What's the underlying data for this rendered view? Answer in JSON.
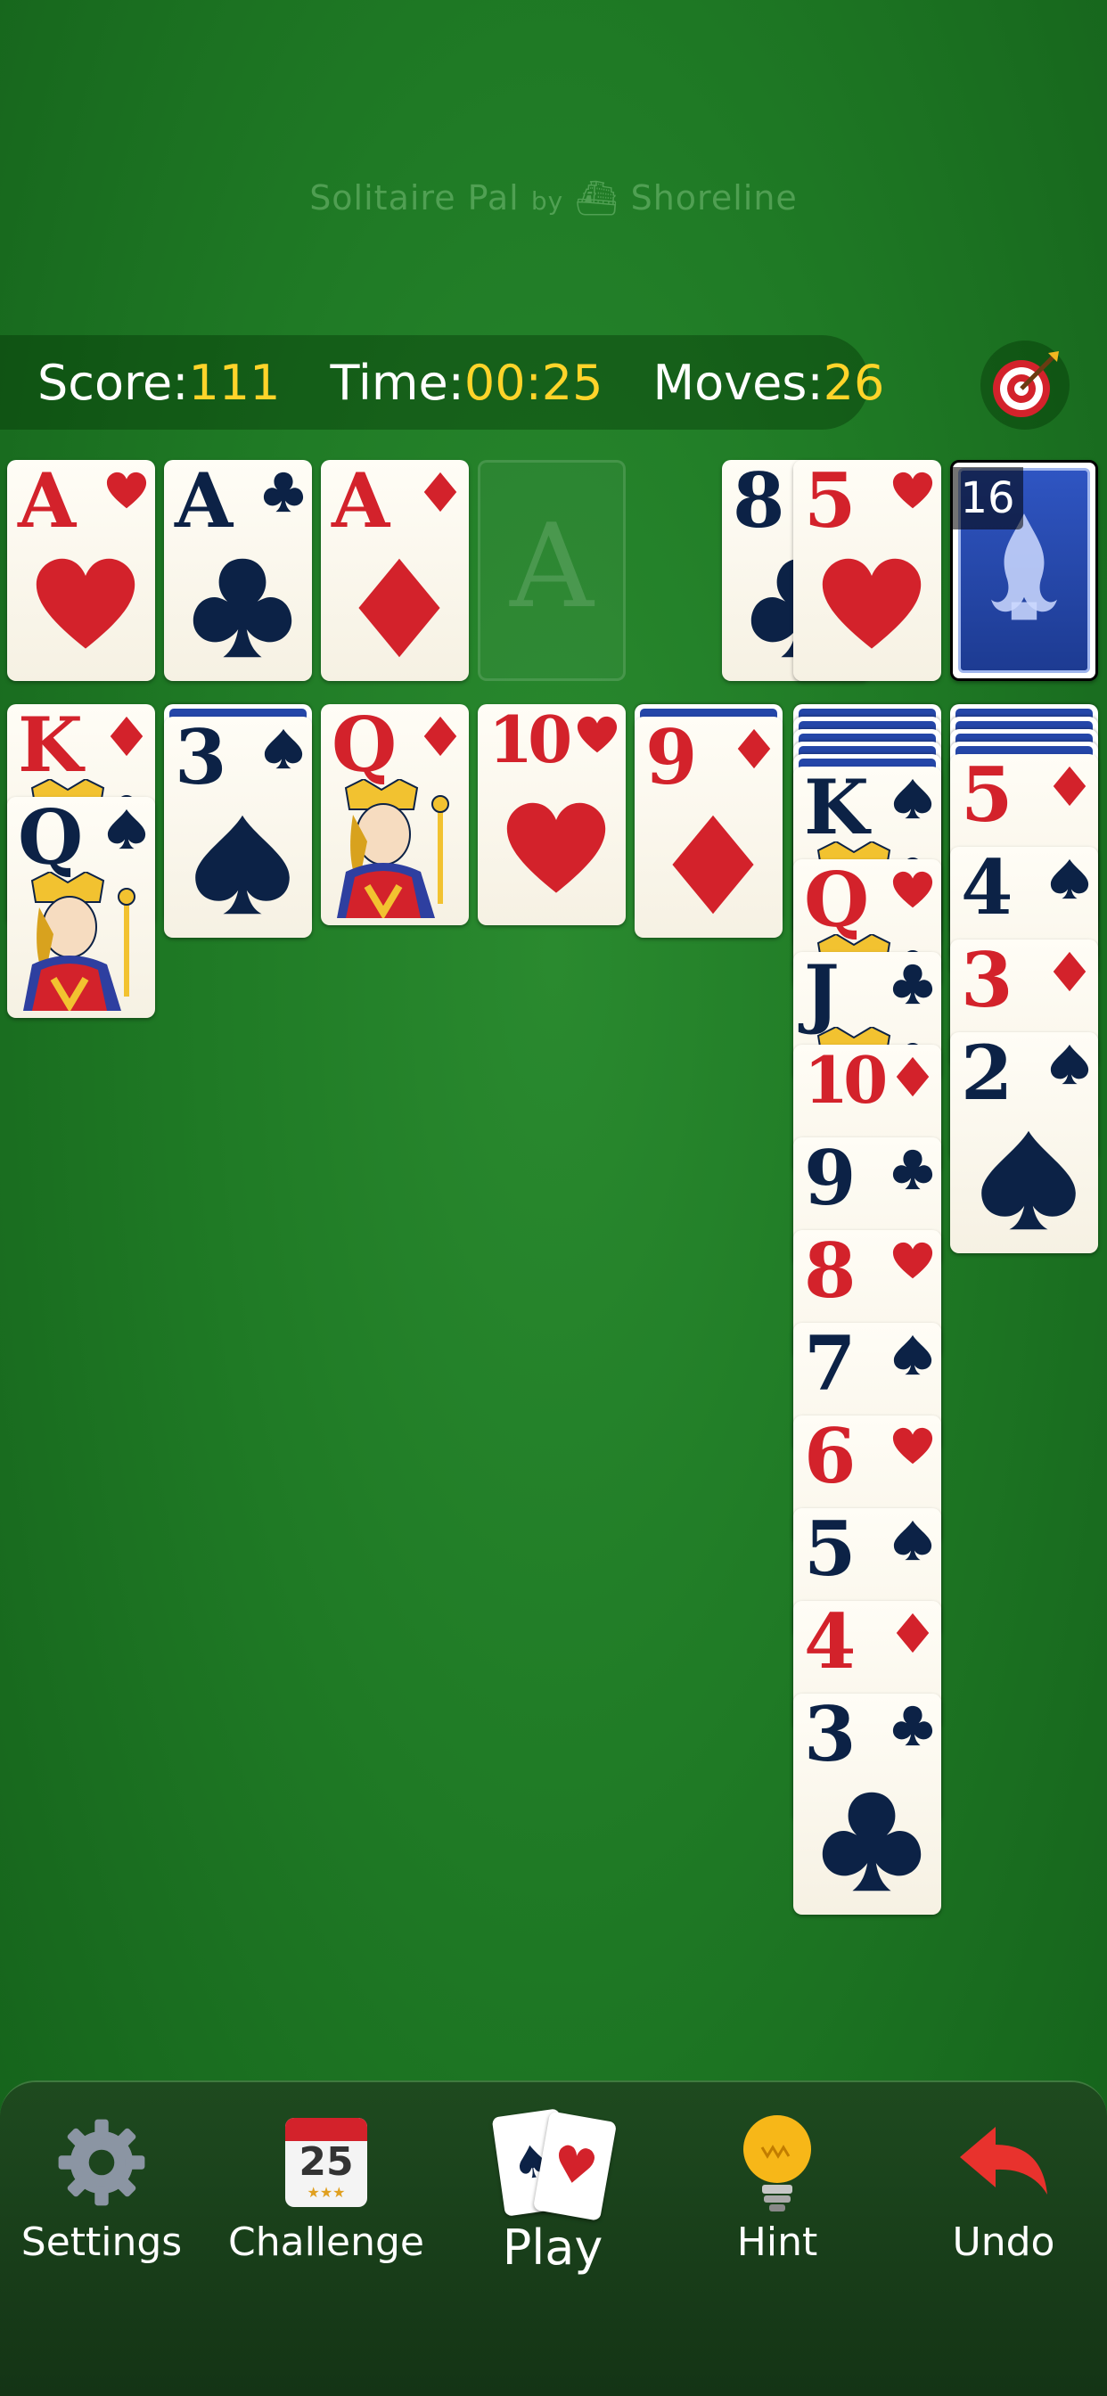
{
  "header": {
    "watermark_title": "Solitaire Pal",
    "watermark_by": "by",
    "watermark_brand": "Shoreline"
  },
  "status": {
    "score_label": "Score:",
    "score_value": "111",
    "time_label": "Time:",
    "time_value": "00:25",
    "moves_label": "Moves:",
    "moves_value": "26"
  },
  "foundations": [
    {
      "rank": "A",
      "suit": "hearts"
    },
    {
      "rank": "A",
      "suit": "clubs"
    },
    {
      "rank": "A",
      "suit": "diamonds"
    },
    {
      "rank": "",
      "suit": "",
      "placeholder": "A"
    }
  ],
  "waste": [
    {
      "rank": "8",
      "suit": "clubs"
    },
    {
      "rank": "5",
      "suit": "hearts"
    }
  ],
  "stock": {
    "count": "16"
  },
  "tableau": [
    {
      "face_down": 0,
      "cards": [
        {
          "rank": "K",
          "suit": "diamonds"
        },
        {
          "rank": "Q",
          "suit": "spades"
        }
      ]
    },
    {
      "face_down": 1,
      "cards": [
        {
          "rank": "3",
          "suit": "spades"
        }
      ]
    },
    {
      "face_down": 0,
      "cards": [
        {
          "rank": "Q",
          "suit": "diamonds"
        }
      ]
    },
    {
      "face_down": 0,
      "cards": [
        {
          "rank": "10",
          "suit": "hearts"
        }
      ]
    },
    {
      "face_down": 1,
      "cards": [
        {
          "rank": "9",
          "suit": "diamonds"
        }
      ]
    },
    {
      "face_down": 5,
      "cards": [
        {
          "rank": "K",
          "suit": "spades"
        },
        {
          "rank": "Q",
          "suit": "hearts"
        },
        {
          "rank": "J",
          "suit": "clubs"
        },
        {
          "rank": "10",
          "suit": "diamonds"
        },
        {
          "rank": "9",
          "suit": "clubs"
        },
        {
          "rank": "8",
          "suit": "hearts"
        },
        {
          "rank": "7",
          "suit": "spades"
        },
        {
          "rank": "6",
          "suit": "hearts"
        },
        {
          "rank": "5",
          "suit": "spades"
        },
        {
          "rank": "4",
          "suit": "diamonds"
        },
        {
          "rank": "3",
          "suit": "clubs"
        }
      ]
    },
    {
      "face_down": 4,
      "cards": [
        {
          "rank": "5",
          "suit": "diamonds"
        },
        {
          "rank": "4",
          "suit": "spades"
        },
        {
          "rank": "3",
          "suit": "diamonds"
        },
        {
          "rank": "2",
          "suit": "spades"
        }
      ]
    }
  ],
  "toolbar": {
    "settings_label": "Settings",
    "challenge_label": "Challenge",
    "challenge_day": "25",
    "play_label": "Play",
    "hint_label": "Hint",
    "undo_label": "Undo"
  },
  "icons": {
    "settings": "gear-icon",
    "challenge": "calendar-icon",
    "play": "cards-icon",
    "hint": "lightbulb-icon",
    "undo": "undo-arrow-icon",
    "target": "target-icon"
  },
  "colors": {
    "felt": "#1f7a25",
    "red_suit": "#d3222b",
    "black_suit": "#0c2246",
    "score_value": "#ffd42a"
  }
}
